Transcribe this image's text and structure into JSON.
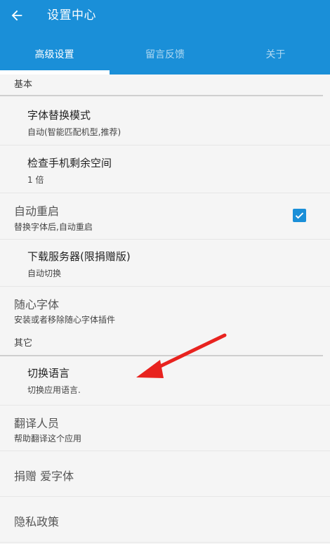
{
  "header": {
    "title": "设置中心"
  },
  "tabs": [
    {
      "label": "高级设置",
      "active": true
    },
    {
      "label": "留言反馈",
      "active": false
    },
    {
      "label": "关于",
      "active": false
    }
  ],
  "sections": {
    "basic": {
      "label": "基本"
    },
    "other": {
      "label": "其它"
    }
  },
  "items": {
    "font_replace": {
      "title": "字体替换模式",
      "subtitle": "自动(智能匹配机型,推荐)"
    },
    "check_space": {
      "title": "检查手机剩余空间",
      "subtitle": "1 倍"
    },
    "auto_reboot": {
      "title": "自动重启",
      "subtitle": "替换字体后,自动重启",
      "checked": true
    },
    "download_server": {
      "title": "下载服务器(限捐赠版)",
      "subtitle": "自动切换"
    },
    "random_font": {
      "title": "随心字体",
      "subtitle": "安装或者移除随心字体插件"
    },
    "switch_language": {
      "title": "切换语言",
      "subtitle": "切换应用语言."
    },
    "translators": {
      "title": "翻译人员",
      "subtitle": "帮助翻译这个应用"
    },
    "donate": {
      "title": "捐赠 爱字体"
    },
    "privacy": {
      "title": "隐私政策"
    }
  },
  "colors": {
    "primary": "#1a8fd8",
    "annotation_arrow": "#e8231f"
  }
}
